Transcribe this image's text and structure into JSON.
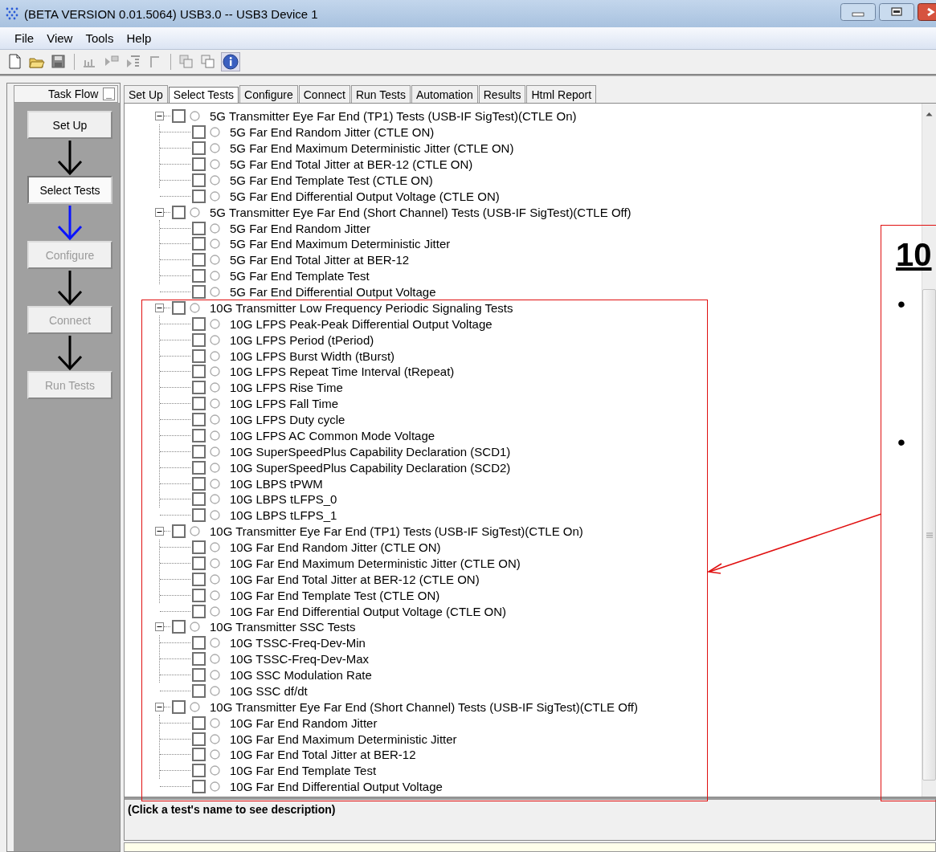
{
  "window": {
    "title": "(BETA VERSION 0.01.5064) USB3.0 -- USB3 Device 1"
  },
  "menu": [
    "File",
    "View",
    "Tools",
    "Help"
  ],
  "task_flow": {
    "title": "Task Flow",
    "collapse": "_",
    "steps": [
      {
        "label": "Set Up",
        "selected": false,
        "disabled": false
      },
      {
        "label": "Select Tests",
        "selected": true,
        "disabled": false
      },
      {
        "label": "Configure",
        "selected": false,
        "disabled": true
      },
      {
        "label": "Connect",
        "selected": false,
        "disabled": true
      },
      {
        "label": "Run Tests",
        "selected": false,
        "disabled": true
      }
    ]
  },
  "tabs": [
    {
      "label": "Set Up",
      "selected": false
    },
    {
      "label": "Select Tests",
      "selected": true
    },
    {
      "label": "Configure",
      "selected": false
    },
    {
      "label": "Connect",
      "selected": false
    },
    {
      "label": "Run Tests",
      "selected": false
    },
    {
      "label": "Automation",
      "selected": false
    },
    {
      "label": "Results",
      "selected": false
    },
    {
      "label": "Html Report",
      "selected": false
    }
  ],
  "tree": [
    {
      "label": "5G Transmitter Eye Far End (TP1) Tests (USB-IF SigTest)(CTLE On)",
      "expanded": true,
      "checked": false,
      "children": [
        {
          "label": "5G Far End Random Jitter (CTLE ON)",
          "checked": false
        },
        {
          "label": "5G Far End Maximum Deterministic Jitter (CTLE ON)",
          "checked": false
        },
        {
          "label": "5G Far End Total Jitter at BER-12 (CTLE ON)",
          "checked": false
        },
        {
          "label": "5G Far End Template Test (CTLE ON)",
          "checked": false
        },
        {
          "label": "5G Far End Differential Output Voltage (CTLE ON)",
          "checked": false
        }
      ]
    },
    {
      "label": "5G Transmitter Eye Far End (Short Channel) Tests (USB-IF SigTest)(CTLE Off)",
      "expanded": true,
      "checked": false,
      "children": [
        {
          "label": "5G Far End Random Jitter",
          "checked": false
        },
        {
          "label": "5G Far End Maximum Deterministic Jitter",
          "checked": false
        },
        {
          "label": "5G Far End Total Jitter at BER-12",
          "checked": false
        },
        {
          "label": "5G Far End Template Test",
          "checked": false
        },
        {
          "label": "5G Far End Differential Output Voltage",
          "checked": false
        }
      ]
    },
    {
      "label": "10G Transmitter Low Frequency Periodic Signaling Tests",
      "expanded": true,
      "checked": false,
      "children": [
        {
          "label": "10G LFPS Peak-Peak Differential Output Voltage",
          "checked": false
        },
        {
          "label": "10G LFPS Period (tPeriod)",
          "checked": false
        },
        {
          "label": "10G LFPS Burst Width (tBurst)",
          "checked": false
        },
        {
          "label": "10G LFPS Repeat Time Interval (tRepeat)",
          "checked": false
        },
        {
          "label": "10G LFPS Rise Time",
          "checked": false
        },
        {
          "label": "10G LFPS Fall Time",
          "checked": false
        },
        {
          "label": "10G LFPS Duty cycle",
          "checked": false
        },
        {
          "label": "10G LFPS AC Common Mode Voltage",
          "checked": false
        },
        {
          "label": "10G SuperSpeedPlus Capability Declaration (SCD1)",
          "checked": false
        },
        {
          "label": "10G SuperSpeedPlus Capability Declaration (SCD2)",
          "checked": false
        },
        {
          "label": "10G LBPS tPWM",
          "checked": false
        },
        {
          "label": "10G LBPS tLFPS_0",
          "checked": false
        },
        {
          "label": "10G LBPS tLFPS_1",
          "checked": false
        }
      ]
    },
    {
      "label": "10G Transmitter Eye Far End (TP1) Tests (USB-IF SigTest)(CTLE On)",
      "expanded": true,
      "checked": false,
      "children": [
        {
          "label": "10G Far End Random Jitter (CTLE ON)",
          "checked": false
        },
        {
          "label": "10G Far End Maximum Deterministic Jitter (CTLE ON)",
          "checked": false
        },
        {
          "label": "10G Far End Total Jitter at BER-12 (CTLE ON)",
          "checked": false
        },
        {
          "label": "10G Far End Template Test (CTLE ON)",
          "checked": false
        },
        {
          "label": "10G Far End Differential Output Voltage (CTLE ON)",
          "checked": false
        }
      ]
    },
    {
      "label": "10G Transmitter SSC Tests",
      "expanded": true,
      "checked": false,
      "children": [
        {
          "label": "10G TSSC-Freq-Dev-Min",
          "checked": false
        },
        {
          "label": "10G TSSC-Freq-Dev-Max",
          "checked": false
        },
        {
          "label": "10G SSC Modulation Rate",
          "checked": false
        },
        {
          "label": "10G SSC df/dt",
          "checked": false
        }
      ]
    },
    {
      "label": "10G Transmitter Eye Far End (Short Channel) Tests (USB-IF SigTest)(CTLE Off)",
      "expanded": true,
      "checked": false,
      "children": [
        {
          "label": "10G Far End Random Jitter",
          "checked": false
        },
        {
          "label": "10G Far End Maximum Deterministic Jitter",
          "checked": false
        },
        {
          "label": "10G Far End Total Jitter at BER-12",
          "checked": false
        },
        {
          "label": "10G Far End Template Test",
          "checked": false
        },
        {
          "label": "10G Far End Differential Output Voltage",
          "checked": false
        }
      ]
    }
  ],
  "description": {
    "text": "(Click a test's name to see description)"
  },
  "callout": {
    "heading": "10",
    "bullets": [
      "•",
      "•"
    ]
  }
}
